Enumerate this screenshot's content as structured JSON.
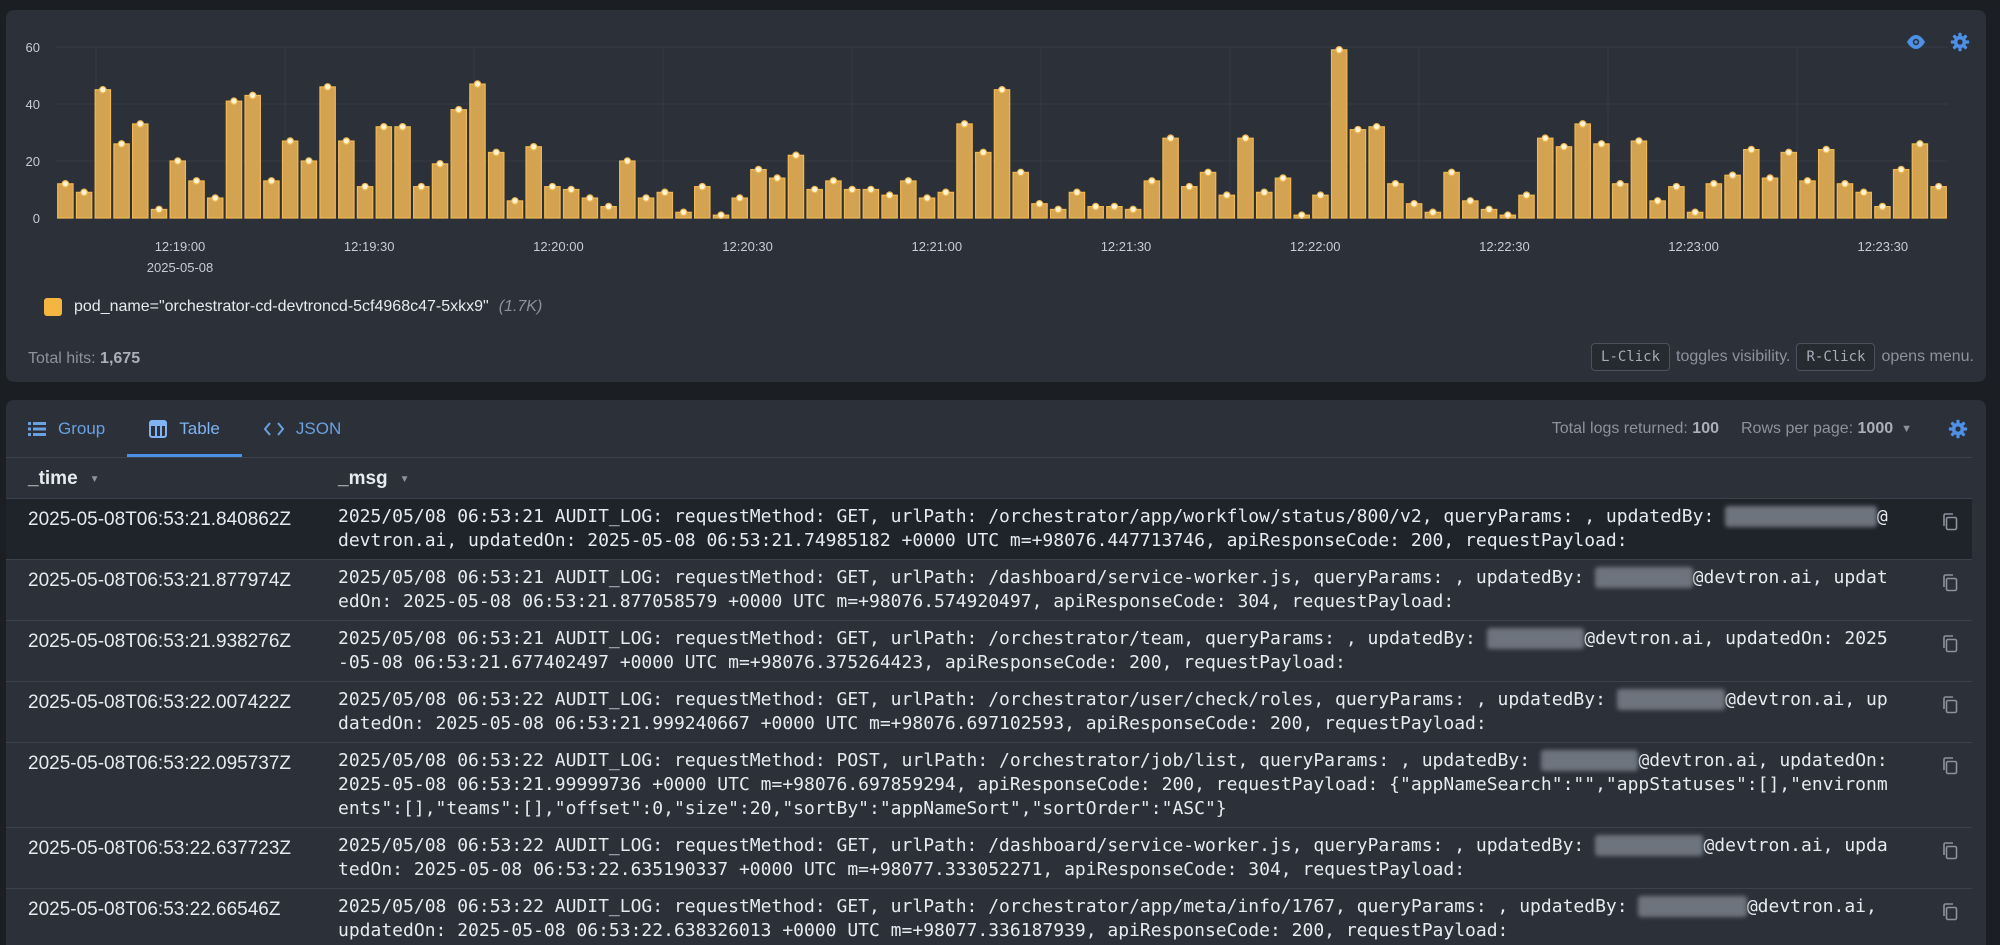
{
  "colors": {
    "accent": "#4d90e6",
    "bar": "#d3a352",
    "bar_border": "#f1b84f",
    "legend": "#f5b541"
  },
  "chart_data": {
    "type": "bar",
    "ylim": [
      0,
      60
    ],
    "y_ticks": [
      "0",
      "20",
      "40",
      "60"
    ],
    "x_ticks": [
      "12:19:00",
      "12:19:30",
      "12:20:00",
      "12:20:30",
      "12:21:00",
      "12:21:30",
      "12:22:00",
      "12:22:30",
      "12:23:00",
      "12:23:30"
    ],
    "x_date": "2025-05-08",
    "series": [
      {
        "name": "pod_name=\"orchestrator-cd-devtroncd-5cf4968c47-5xkx9\"",
        "values": [
          12,
          9,
          45,
          26,
          33,
          3,
          20,
          13,
          7,
          41,
          43,
          13,
          27,
          20,
          46,
          27,
          11,
          32,
          32,
          11,
          19,
          38,
          47,
          23,
          6,
          25,
          11,
          10,
          7,
          4,
          20,
          7,
          9,
          2,
          11,
          1,
          7,
          17,
          14,
          22,
          10,
          13,
          10,
          10,
          8,
          13,
          7,
          9,
          33,
          23,
          45,
          16,
          5,
          3,
          9,
          4,
          4,
          3,
          13,
          28,
          11,
          16,
          8,
          28,
          9,
          14,
          1,
          8,
          59,
          31,
          32,
          12,
          5,
          2,
          16,
          6,
          3,
          1,
          8,
          28,
          25,
          33,
          26,
          12,
          27,
          6,
          11,
          2,
          12,
          15,
          24,
          14,
          23,
          13,
          24,
          12,
          9,
          4,
          17,
          26,
          11
        ]
      }
    ]
  },
  "chart": {
    "legend_label": "pod_name=\"orchestrator-cd-devtroncd-5cf4968c47-5xkx9\"",
    "legend_count": "(1.7K)",
    "total_hits_label": "Total hits:",
    "total_hits_value": "1,675",
    "hint_lclick": "L-Click",
    "hint_lclick_text": "toggles visibility.",
    "hint_rclick": "R-Click",
    "hint_rclick_text": "opens menu.",
    "icons": [
      "eye-icon",
      "gear-icon"
    ]
  },
  "logs_view": {
    "tabs": [
      {
        "label": "Group",
        "icon": "list-icon"
      },
      {
        "label": "Table",
        "icon": "table-icon"
      },
      {
        "label": "JSON",
        "icon": "code-icon"
      }
    ],
    "active_tab": "Table",
    "total_logs_label": "Total logs returned:",
    "total_logs_value": "100",
    "rows_per_page_label": "Rows per page:",
    "rows_per_page_value": "1000",
    "columns": [
      "_time",
      "_msg"
    ],
    "rows": [
      {
        "time": "2025-05-08T06:53:21.840862Z",
        "msg_a": "2025/05/08 06:53:21 AUDIT_LOG: requestMethod: GET, urlPath: /orchestrator/app/workflow/status/800/v2, queryParams: , updatedBy: ",
        "redacted": "xxxxxxx.xxxxxx",
        "msg_b": "@devtron.ai, updatedOn: 2025-05-08 06:53:21.74985182 +0000 UTC m=+98076.447713746, apiResponseCode: 200, requestPayload:"
      },
      {
        "time": "2025-05-08T06:53:21.877974Z",
        "msg_a": "2025/05/08 06:53:21 AUDIT_LOG: requestMethod: GET, urlPath: /dashboard/service-worker.js, queryParams: , updatedBy: ",
        "redacted": "xxxxxxxxx",
        "msg_b": "@devtron.ai, updatedOn: 2025-05-08 06:53:21.877058579 +0000 UTC m=+98076.574920497, apiResponseCode: 304, requestPayload:"
      },
      {
        "time": "2025-05-08T06:53:21.938276Z",
        "msg_a": "2025/05/08 06:53:21 AUDIT_LOG: requestMethod: GET, urlPath: /orchestrator/team, queryParams: , updatedBy: ",
        "redacted": "xxxxxxxxx",
        "msg_b": "@devtron.ai, updatedOn: 2025-05-08 06:53:21.677402497 +0000 UTC m=+98076.375264423, apiResponseCode: 200, requestPayload:"
      },
      {
        "time": "2025-05-08T06:53:22.007422Z",
        "msg_a": "2025/05/08 06:53:22 AUDIT_LOG: requestMethod: GET, urlPath: /orchestrator/user/check/roles, queryParams: , updatedBy: ",
        "redacted": "xxxxxxxxxx",
        "msg_b": "@devtron.ai, updatedOn: 2025-05-08 06:53:21.999240667 +0000 UTC m=+98076.697102593, apiResponseCode: 200, requestPayload:"
      },
      {
        "time": "2025-05-08T06:53:22.095737Z",
        "msg_a": "2025/05/08 06:53:22 AUDIT_LOG: requestMethod: POST, urlPath: /orchestrator/job/list, queryParams: , updatedBy: ",
        "redacted": "xxxxxxxxx",
        "msg_b": "@devtron.ai, updatedOn: 2025-05-08 06:53:21.99999736 +0000 UTC m=+98076.697859294, apiResponseCode: 200, requestPayload: {\"appNameSearch\":\"\",\"appStatuses\":[],\"environments\":[],\"teams\":[],\"offset\":0,\"size\":20,\"sortBy\":\"appNameSort\",\"sortOrder\":\"ASC\"}"
      },
      {
        "time": "2025-05-08T06:53:22.637723Z",
        "msg_a": "2025/05/08 06:53:22 AUDIT_LOG: requestMethod: GET, urlPath: /dashboard/service-worker.js, queryParams: , updatedBy: ",
        "redacted": "xxxxxxxxxx",
        "msg_b": "@devtron.ai, updatedOn: 2025-05-08 06:53:22.635190337 +0000 UTC m=+98077.333052271, apiResponseCode: 304, requestPayload:"
      },
      {
        "time": "2025-05-08T06:53:22.66546Z",
        "msg_a": "2025/05/08 06:53:22 AUDIT_LOG: requestMethod: GET, urlPath: /orchestrator/app/meta/info/1767, queryParams: , updatedBy: ",
        "redacted": "xxxxxxxxxx",
        "msg_b": "@devtron.ai, updatedOn: 2025-05-08 06:53:22.638326013 +0000 UTC m=+98077.336187939, apiResponseCode: 200, requestPayload:"
      }
    ]
  }
}
